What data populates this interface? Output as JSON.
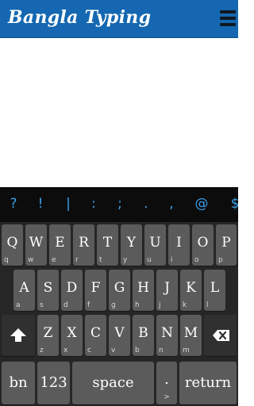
{
  "app": {
    "title": "Bangla Typing"
  },
  "symbols": [
    "?",
    "!",
    "|",
    ":",
    ";",
    ".",
    ",",
    "@",
    "$"
  ],
  "keyboard": {
    "row1": [
      {
        "main": "Q",
        "sub": "q"
      },
      {
        "main": "W",
        "sub": "w"
      },
      {
        "main": "E",
        "sub": "e"
      },
      {
        "main": "R",
        "sub": "r"
      },
      {
        "main": "T",
        "sub": "t"
      },
      {
        "main": "Y",
        "sub": "y"
      },
      {
        "main": "U",
        "sub": "u"
      },
      {
        "main": "I",
        "sub": "i"
      },
      {
        "main": "O",
        "sub": "o"
      },
      {
        "main": "P",
        "sub": "p"
      }
    ],
    "row2": [
      {
        "main": "A",
        "sub": "a"
      },
      {
        "main": "S",
        "sub": "s"
      },
      {
        "main": "D",
        "sub": "d"
      },
      {
        "main": "F",
        "sub": "f"
      },
      {
        "main": "G",
        "sub": "g"
      },
      {
        "main": "H",
        "sub": "h"
      },
      {
        "main": "J",
        "sub": "j"
      },
      {
        "main": "K",
        "sub": "k"
      },
      {
        "main": "L",
        "sub": "l"
      }
    ],
    "row3": [
      {
        "main": "Z",
        "sub": "z"
      },
      {
        "main": "X",
        "sub": "x"
      },
      {
        "main": "C",
        "sub": "c"
      },
      {
        "main": "V",
        "sub": "v"
      },
      {
        "main": "B",
        "sub": "b"
      },
      {
        "main": "N",
        "sub": "n"
      },
      {
        "main": "M",
        "sub": "m"
      }
    ],
    "bottom": {
      "lang": "bn",
      "numbers": "123",
      "space": "space",
      "dot": ".",
      "dot_sub": ">",
      "return": "return"
    }
  },
  "colors": {
    "appbar": "#1467b0",
    "symbol": "#3aa0e8",
    "key": "#5b5b5b",
    "keyboard_bg": "#262626"
  }
}
